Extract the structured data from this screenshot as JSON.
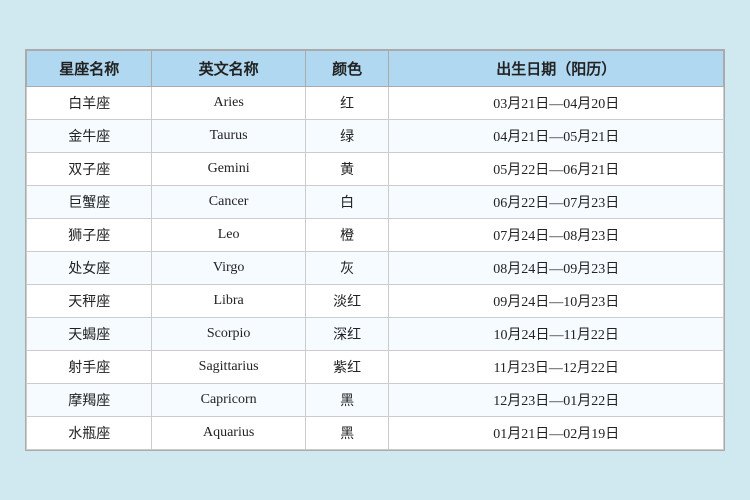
{
  "table": {
    "headers": [
      "星座名称",
      "英文名称",
      "颜色",
      "出生日期（阳历）"
    ],
    "rows": [
      {
        "zh": "白羊座",
        "en": "Aries",
        "color": "红",
        "date": "03月21日—04月20日"
      },
      {
        "zh": "金牛座",
        "en": "Taurus",
        "color": "绿",
        "date": "04月21日—05月21日"
      },
      {
        "zh": "双子座",
        "en": "Gemini",
        "color": "黄",
        "date": "05月22日—06月21日"
      },
      {
        "zh": "巨蟹座",
        "en": "Cancer",
        "color": "白",
        "date": "06月22日—07月23日"
      },
      {
        "zh": "狮子座",
        "en": "Leo",
        "color": "橙",
        "date": "07月24日—08月23日"
      },
      {
        "zh": "处女座",
        "en": "Virgo",
        "color": "灰",
        "date": "08月24日—09月23日"
      },
      {
        "zh": "天秤座",
        "en": "Libra",
        "color": "淡红",
        "date": "09月24日—10月23日"
      },
      {
        "zh": "天蝎座",
        "en": "Scorpio",
        "color": "深红",
        "date": "10月24日—11月22日"
      },
      {
        "zh": "射手座",
        "en": "Sagittarius",
        "color": "紫红",
        "date": "11月23日—12月22日"
      },
      {
        "zh": "摩羯座",
        "en": "Capricorn",
        "color": "黑",
        "date": "12月23日—01月22日"
      },
      {
        "zh": "水瓶座",
        "en": "Aquarius",
        "color": "黑",
        "date": "01月21日—02月19日"
      }
    ]
  }
}
